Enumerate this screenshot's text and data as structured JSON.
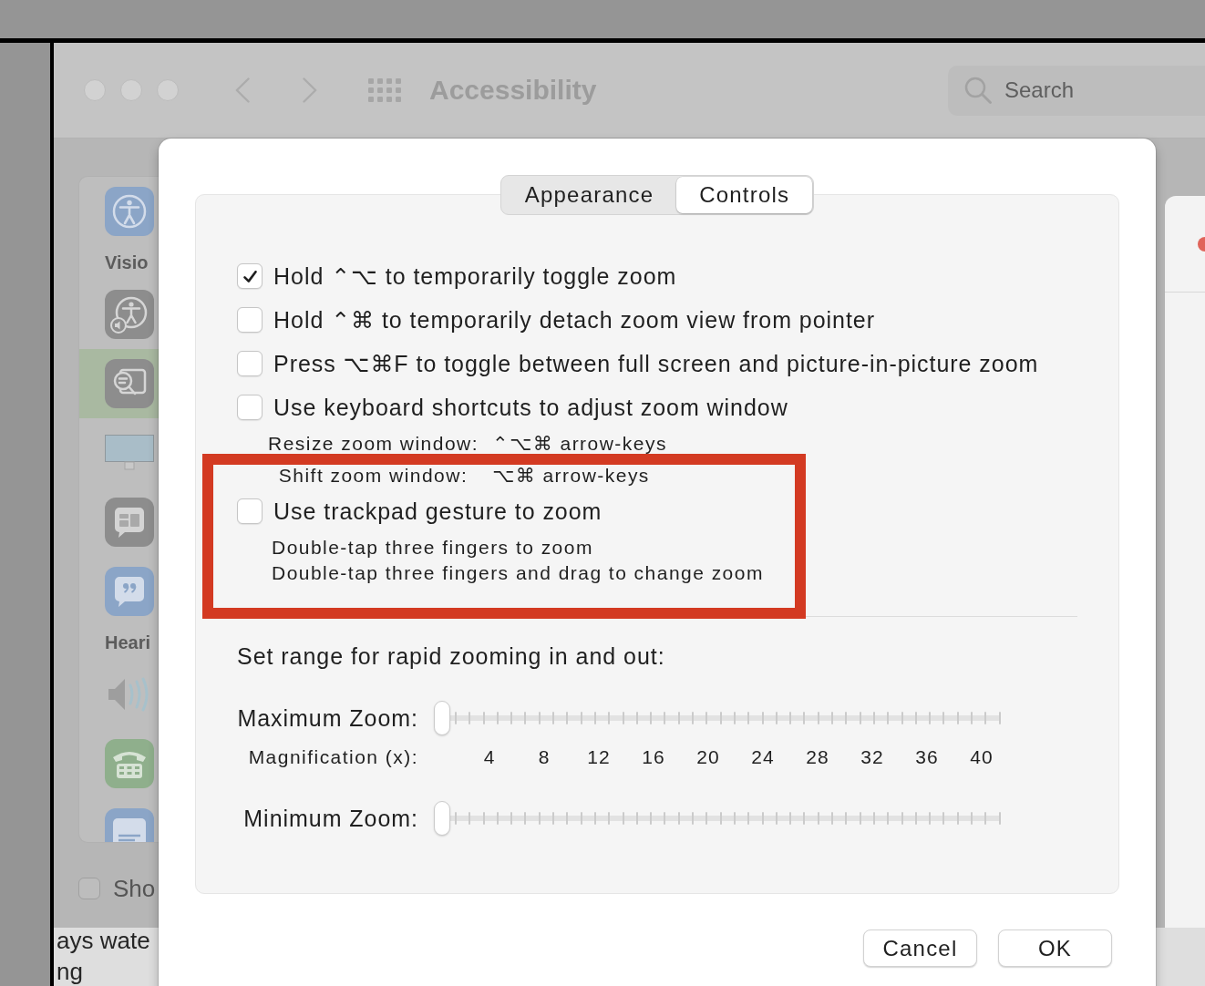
{
  "window": {
    "title": "Accessibility",
    "search": {
      "placeholder": "Search"
    }
  },
  "sidebar": {
    "sections": [
      {
        "label": "Visio",
        "items": [
          {
            "selected": false
          },
          {
            "selected": true
          },
          {
            "selected": false
          },
          {
            "selected": false
          },
          {
            "selected": false
          }
        ]
      },
      {
        "label": "Heari",
        "items": [
          {
            "selected": false
          },
          {
            "selected": false
          },
          {
            "selected": false
          }
        ]
      }
    ],
    "footer_checkbox": {
      "label": "Sho",
      "checked": false
    }
  },
  "background_text": [
    "ays wate",
    "ng"
  ],
  "dialog": {
    "tabs": [
      {
        "label": "Appearance",
        "selected": false
      },
      {
        "label": "Controls",
        "selected": true
      }
    ],
    "options": [
      {
        "label": "Hold ⌃⌥ to temporarily toggle zoom",
        "checked": true,
        "highlighted": false
      },
      {
        "label": "Hold ⌃⌘ to temporarily detach zoom view from pointer",
        "checked": false,
        "highlighted": false
      },
      {
        "label": "Press ⌥⌘F to toggle between full screen and picture-in-picture zoom",
        "checked": false,
        "highlighted": false
      },
      {
        "label": "Use keyboard shortcuts to adjust zoom window",
        "checked": false,
        "highlighted": false,
        "shortcuts": [
          {
            "action": "Resize zoom window:",
            "keys": "⌃⌥⌘ arrow-keys"
          },
          {
            "action": "Shift zoom window:",
            "keys": "⌥⌘ arrow-keys"
          }
        ]
      },
      {
        "label": "Use trackpad gesture to zoom",
        "checked": false,
        "highlighted": true,
        "notes": [
          "Double-tap three fingers to zoom",
          "Double-tap three fingers and drag to change zoom"
        ]
      }
    ],
    "range_heading": "Set range for rapid zooming in and out:",
    "sliders": [
      {
        "label": "Maximum Zoom:",
        "level": 0,
        "scale": {
          "label": "Magnification (x):",
          "values": [
            "4",
            "8",
            "12",
            "16",
            "20",
            "24",
            "28",
            "32",
            "36",
            "40"
          ]
        }
      },
      {
        "label": "Minimum Zoom:",
        "level": 0
      }
    ],
    "buttons": [
      "Cancel",
      "OK"
    ]
  }
}
